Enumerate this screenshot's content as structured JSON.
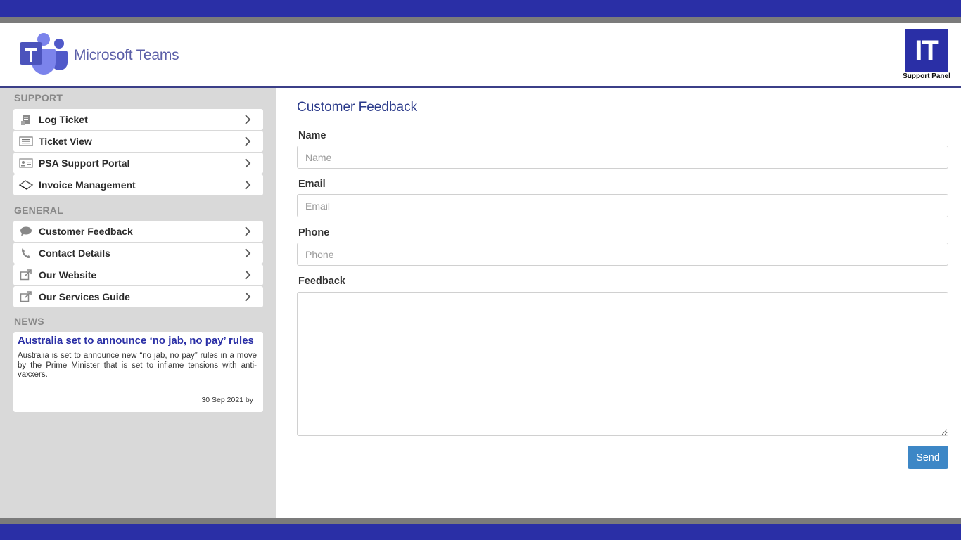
{
  "header": {
    "app_title": "Microsoft Teams",
    "badge_text": "IT",
    "badge_caption": "Support Panel"
  },
  "colors": {
    "brand_blue": "#2a2fa6",
    "accent_button": "#3d87c6",
    "sidebar_bg": "#d9d9d9"
  },
  "sidebar": {
    "support_heading": "SUPPORT",
    "support_items": [
      {
        "label": "Log Ticket",
        "icon": "ticket-icon"
      },
      {
        "label": "Ticket View",
        "icon": "list-icon"
      },
      {
        "label": "PSA Support Portal",
        "icon": "id-card-icon"
      },
      {
        "label": "Invoice Management",
        "icon": "tag-icon"
      }
    ],
    "general_heading": "GENERAL",
    "general_items": [
      {
        "label": "Customer Feedback",
        "icon": "chat-bubble-icon"
      },
      {
        "label": "Contact Details",
        "icon": "phone-icon"
      },
      {
        "label": "Our Website",
        "icon": "external-link-icon"
      },
      {
        "label": "Our Services Guide",
        "icon": "external-link-icon"
      }
    ],
    "news_heading": "NEWS",
    "news": {
      "title": "Australia set to announce ‘no jab, no pay’ rules",
      "body": "Australia is set to announce new “no jab, no pay” rules in a move by the Prime Minister that is set to inflame tensions with anti-vaxxers.",
      "meta": "30 Sep 2021  by"
    }
  },
  "main": {
    "title": "Customer Feedback",
    "fields": {
      "name_label": "Name",
      "name_placeholder": "Name",
      "email_label": "Email",
      "email_placeholder": "Email",
      "phone_label": "Phone",
      "phone_placeholder": "Phone",
      "feedback_label": "Feedback"
    },
    "send_label": "Send"
  }
}
